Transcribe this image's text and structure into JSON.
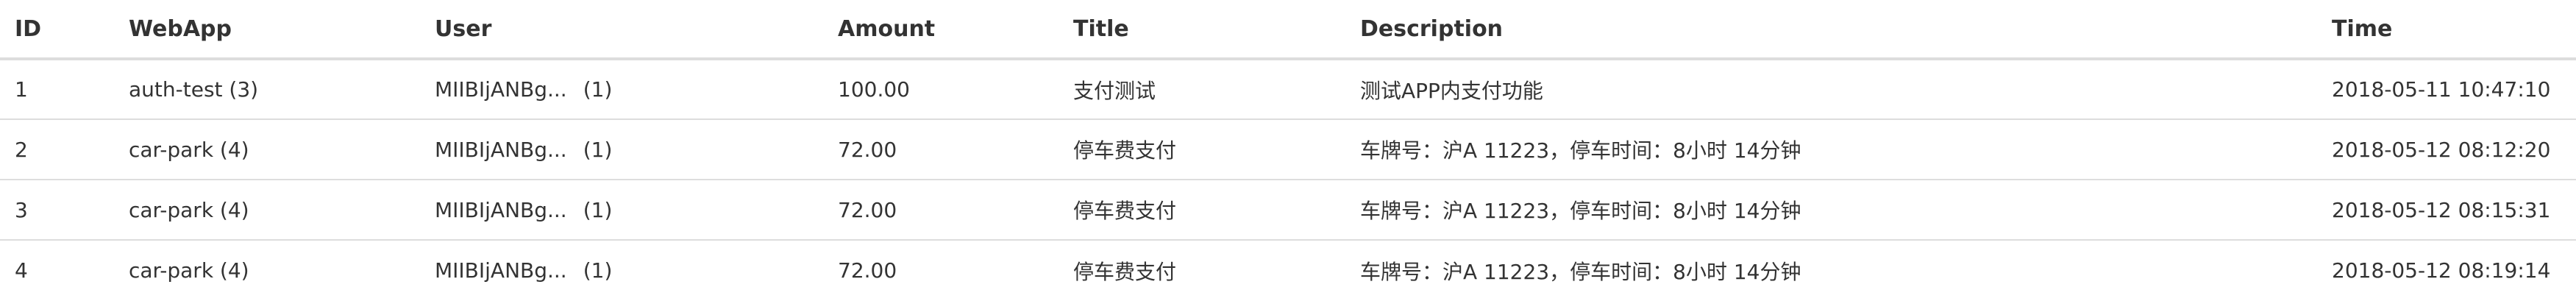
{
  "table": {
    "columns": [
      "ID",
      "WebApp",
      "User",
      "Amount",
      "Title",
      "Description",
      "Time"
    ],
    "rows": [
      {
        "id": "1",
        "webapp": "auth-test (3)",
        "user": "MIIBIjANBg...",
        "user_count": "(1)",
        "amount": "100.00",
        "title": "支付测试",
        "description": "测试APP内支付功能",
        "time": "2018-05-11 10:47:10"
      },
      {
        "id": "2",
        "webapp": "car-park (4)",
        "user": "MIIBIjANBg...",
        "user_count": "(1)",
        "amount": "72.00",
        "title": "停车费支付",
        "description": "车牌号：沪A 11223，停车时间：8小时 14分钟",
        "time": "2018-05-12 08:12:20"
      },
      {
        "id": "3",
        "webapp": "car-park (4)",
        "user": "MIIBIjANBg...",
        "user_count": "(1)",
        "amount": "72.00",
        "title": "停车费支付",
        "description": "车牌号：沪A 11223，停车时间：8小时 14分钟",
        "time": "2018-05-12 08:15:31"
      },
      {
        "id": "4",
        "webapp": "car-park (4)",
        "user": "MIIBIjANBg...",
        "user_count": "(1)",
        "amount": "72.00",
        "title": "停车费支付",
        "description": "车牌号：沪A 11223，停车时间：8小时 14分钟",
        "time": "2018-05-12 08:19:14"
      }
    ]
  }
}
